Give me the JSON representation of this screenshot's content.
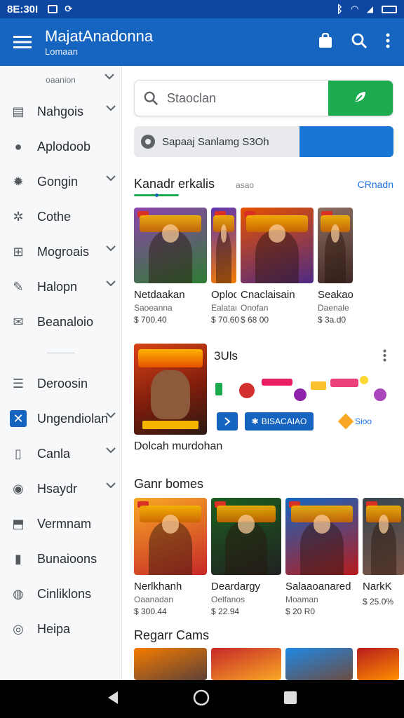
{
  "status_bar": {
    "time": "8E:30I"
  },
  "app_bar": {
    "title": "MajatAnadonna",
    "subtitle": "Lomaan",
    "colors": {
      "bar": "#1565c0",
      "status": "#0d47a1"
    }
  },
  "drawer": {
    "top_hint": "oaanion",
    "items": [
      {
        "label": "Nahgois",
        "icon": "calendar-icon",
        "expandable": true
      },
      {
        "label": "Aplodoob",
        "icon": "account-icon",
        "expandable": false
      },
      {
        "label": "Gongin",
        "icon": "gear-icon",
        "expandable": true
      },
      {
        "label": "Cothe",
        "icon": "puzzle-icon",
        "expandable": false
      },
      {
        "label": "Mogroais",
        "icon": "map-icon",
        "expandable": true
      },
      {
        "label": "Halopn",
        "icon": "edit-icon",
        "expandable": true
      },
      {
        "label": "Beanaloio",
        "icon": "mail-icon",
        "expandable": false
      },
      {
        "label": "Deroosin",
        "icon": "list-icon",
        "expandable": false
      },
      {
        "label": "Ungendiolan",
        "icon": "cross-icon",
        "expandable": true,
        "active": true
      },
      {
        "label": "Canla",
        "icon": "doc-icon",
        "expandable": true
      },
      {
        "label": "Hsaydr",
        "icon": "circle-icon",
        "expandable": true
      },
      {
        "label": "Vermnam",
        "icon": "pin-icon",
        "expandable": false
      },
      {
        "label": "Bunaioons",
        "icon": "folder-icon",
        "expandable": false
      },
      {
        "label": "Cinliklons",
        "icon": "chat-icon",
        "expandable": false
      },
      {
        "label": "Heipa",
        "icon": "help-icon",
        "expandable": false
      }
    ]
  },
  "search": {
    "placeholder": "Staoclan"
  },
  "promo": {
    "text": "Sapaaj Sanlamg S3Oh"
  },
  "section1": {
    "title": "Kanadr erkalis",
    "subtitle": "asao",
    "more": "CRnadn",
    "cards": [
      {
        "name": "Netdaakan",
        "dev": "Saoeanna",
        "price": "$ 700.40",
        "c1": "#8e44ad",
        "c2": "#2e7d32"
      },
      {
        "name": "Oplodakain",
        "dev": "Ealatan",
        "price": "$ 70.60",
        "c1": "#5e35b1",
        "c2": "#f57c00"
      },
      {
        "name": "Cnaclaisain",
        "dev": "Onofan",
        "price": "$ 68 00",
        "c1": "#e65100",
        "c2": "#4e2a84"
      },
      {
        "name": "Seakao",
        "dev": "Daenale",
        "price": "$ 3a.d0",
        "c1": "#8d6e63",
        "c2": "#3e2723"
      }
    ]
  },
  "featured": {
    "title": "3Uls",
    "button_label": "BISACAIAO",
    "side_label": "Sioo",
    "caption": "Dolcah murdohan"
  },
  "section2": {
    "title": "Ganr bomes",
    "cards": [
      {
        "name": "Nerlkhanh",
        "dev": "Oaanadan",
        "price": "$ 300.44",
        "c1": "#f9a825",
        "c2": "#c62828"
      },
      {
        "name": "Deardargy",
        "dev": "Oelfanos",
        "price": "$ 22.94",
        "c1": "#1b5e20",
        "c2": "#212121"
      },
      {
        "name": "Salaaoanared",
        "dev": "Moaman",
        "price": "$ 20 R0",
        "c1": "#1565c0",
        "c2": "#b71c1c"
      },
      {
        "name": "NarkK",
        "dev": "",
        "price": "$ 25.0%",
        "c1": "#37474f",
        "c2": "#795548"
      }
    ]
  },
  "section3": {
    "title": "Regarr Cams"
  }
}
